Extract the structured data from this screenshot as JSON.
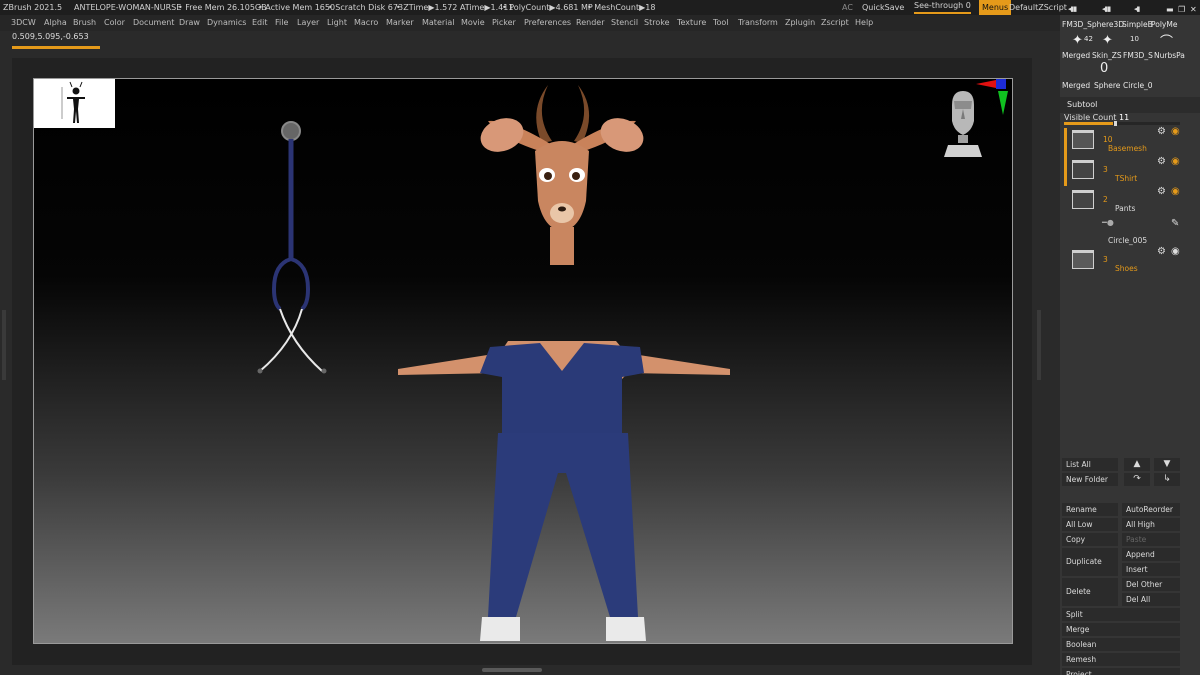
{
  "titlebar": {
    "app": "ZBrush 2021.5",
    "document": "ANTELOPE-WOMAN-NURSE",
    "free_mem": "• Free Mem 26.105GB",
    "active_mem": "• Active Mem 1650",
    "scratch_disk": "• Scratch Disk 673",
    "ztime": "• ZTime▶1.572 ATime▶1.411",
    "polycount": "• PolyCount▶4.681 MP",
    "meshcount": "• MeshCount▶18",
    "ac": "AC",
    "quicksave": "QuickSave",
    "see_through": "See-through  0",
    "menus": "Menus",
    "script": "DefaultZScript"
  },
  "menubar": [
    "3DCW",
    "Alpha",
    "Brush",
    "Color",
    "Document",
    "Draw",
    "Dynamics",
    "Edit",
    "File",
    "Layer",
    "Light",
    "Macro",
    "Marker",
    "Material",
    "Movie",
    "Picker",
    "Preferences",
    "Render",
    "Stencil",
    "Stroke",
    "Texture",
    "Tool",
    "Transform",
    "Zplugin",
    "Zscript",
    "Help"
  ],
  "coords": "0.509,5.095,-0.653",
  "tools": {
    "row1": [
      "FM3D_Sphere3D",
      "SimpleB",
      "PolyMe"
    ],
    "row2_counts": [
      "42",
      "10"
    ],
    "row2": [
      "Merged",
      "Skin_ZS",
      "FM3D_S",
      "NurbsPa"
    ],
    "row3": [
      "Merged",
      "Sphere",
      "Circle_0"
    ]
  },
  "subtool": {
    "header": "Subtool",
    "visible_label": "Visible Count",
    "visible_value": "11",
    "visible_fraction": 0.42,
    "items": [
      {
        "count": "10",
        "name": "Basemesh"
      },
      {
        "count": "3",
        "name": "TShirt"
      },
      {
        "count": "2",
        "name": "Pants"
      },
      {
        "count": "",
        "name": "Circle_005"
      },
      {
        "count": "3",
        "name": "Shoes"
      }
    ]
  },
  "buttons": {
    "list_all": "List All",
    "new_folder": "New Folder",
    "rename": "Rename",
    "auto_reorder": "AutoReorder",
    "all_low": "All Low",
    "all_high": "All High",
    "copy": "Copy",
    "paste": "Paste",
    "duplicate": "Duplicate",
    "append": "Append",
    "insert": "Insert",
    "delete": "Delete",
    "del_other": "Del Other",
    "del_all": "Del All",
    "split": "Split",
    "merge": "Merge",
    "boolean": "Boolean",
    "remesh": "Remesh",
    "project": "Project"
  },
  "icons": {
    "arrow_up": "▲",
    "arrow_down": "▼",
    "redo": "↷",
    "return": "↳",
    "gear": "⚙",
    "eye": "◉"
  },
  "colors": {
    "accent": "#e59a1a",
    "panel": "#353535",
    "scrubs": "#2a3a78"
  }
}
